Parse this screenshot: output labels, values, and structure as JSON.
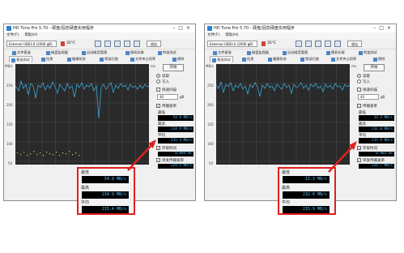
{
  "app": {
    "title": "HD Tune Pro 5.70 - 硬盘/固态硬盘实用程序",
    "window_buttons": [
      "–",
      "□",
      "×"
    ],
    "menu": [
      "文件(F)",
      "帮助(H)"
    ],
    "drive": "External USB3.0 (2000 gB)",
    "temperature": "35°C",
    "exit_label": "退出",
    "tabs_row1": [
      "文件基准",
      "磁盘监视器",
      "自动噪音管理",
      "随机存取",
      "附加测试"
    ],
    "tabs_row2": [
      "基准测试",
      "信息",
      "健康状态",
      "错误扫描",
      "文件夹占用率",
      "擦除"
    ],
    "chart_axis_left": [
      "MB/s",
      "250",
      "200",
      "150",
      "100",
      "50"
    ],
    "chart_axis_right": [
      "ms",
      "50",
      "40",
      "30",
      "20",
      "10"
    ],
    "side": {
      "start_label": "开始",
      "read_label": "读取",
      "write_label": "写入",
      "quick_scan_label": "快速扫描",
      "quick_scan_value": "40",
      "quick_scan_unit": "gB",
      "transfer_label": "传输速率",
      "min_label": "最低",
      "max_label": "最高",
      "avg_label": "平均",
      "access_label": "存取时间",
      "burst_label": "突发传输速率",
      "cpu_label": "CPU 占用率"
    },
    "colors": {
      "chart_bg": "#2a2a2a",
      "read_line": "#3aa8d8",
      "access_dots": "#d8d030",
      "lcd_text": "#5ec1ff",
      "callout_border": "#e02020"
    }
  },
  "left": {
    "min": "54.9 MB/s",
    "max": "234.9 MB/s",
    "avg": "215.4 MB/s",
    "access": "0.094 ms",
    "burst": "224.5 MB/s",
    "cpu": "1.3%"
  },
  "right": {
    "min": "13.3 MB/s",
    "max": "232.0 MB/s",
    "avg": "215.9 MB/s",
    "access": "0.905 ms",
    "burst": "224.7 MB/s",
    "cpu": "1.5%"
  }
}
